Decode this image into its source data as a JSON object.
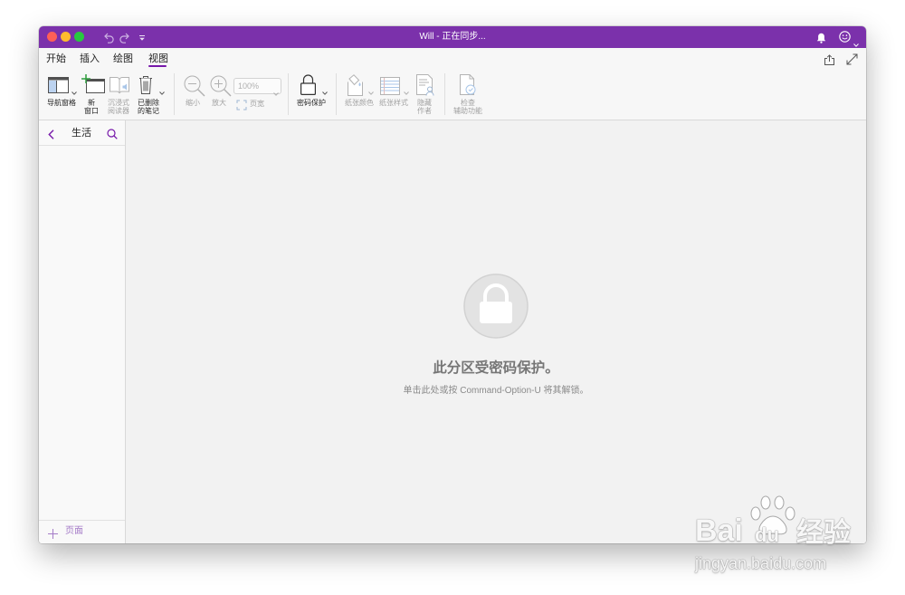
{
  "window": {
    "title": "Will - 正在同步..."
  },
  "theme": {
    "titlebar": "#7B31AB",
    "accent": "#7719AA",
    "ribbon_bg": "#F7F7F7",
    "canvas_bg": "#F2F2F2"
  },
  "quick_access": {
    "icons": [
      "undo-icon",
      "redo-icon",
      "customize-toolbar-icon"
    ]
  },
  "titlebar_right": {
    "icons": [
      "bell-icon",
      "feedback-smiley-icon",
      "chevron-down-icon"
    ]
  },
  "tabs": [
    {
      "label": "开始",
      "selected": false
    },
    {
      "label": "插入",
      "selected": false
    },
    {
      "label": "绘图",
      "selected": false
    },
    {
      "label": "视图",
      "selected": true
    }
  ],
  "tab_row_right": {
    "icons": [
      "share-icon",
      "expand-icon"
    ]
  },
  "ribbon": {
    "navigation_pane": {
      "label": "导航窗格",
      "enabled": true,
      "icon": "navigation-pane-icon"
    },
    "new_window": {
      "line1": "新",
      "line2": "窗口",
      "enabled": true,
      "icon": "new-window-icon"
    },
    "immersive_reader": {
      "line1": "沉浸式",
      "line2": "阅读器",
      "enabled": false,
      "icon": "immersive-reader-icon"
    },
    "deleted_notes": {
      "line1": "已删除",
      "line2": "的笔记",
      "enabled": true,
      "icon": "trash-icon"
    },
    "zoom_out": {
      "label": "缩小",
      "enabled": false,
      "icon": "zoom-out-icon"
    },
    "zoom_in": {
      "label": "放大",
      "enabled": false,
      "icon": "zoom-in-icon"
    },
    "zoom_level": {
      "value": "100%",
      "enabled": false
    },
    "page_width": {
      "label": "页宽",
      "enabled": false,
      "icon": "page-width-icon"
    },
    "password_protection": {
      "label": "密码保护",
      "enabled": true,
      "icon": "lock-icon"
    },
    "paper_color": {
      "label": "纸张颜色",
      "enabled": false,
      "icon": "paper-color-icon"
    },
    "paper_style": {
      "label": "纸张样式",
      "enabled": false,
      "icon": "paper-style-icon"
    },
    "hide_authors": {
      "line1": "隐藏",
      "line2": "作者",
      "enabled": false,
      "icon": "hide-authors-icon"
    },
    "check_accessibility": {
      "line1": "检查",
      "line2": "辅助功能",
      "enabled": false,
      "icon": "accessibility-icon"
    }
  },
  "sidebar": {
    "section": "生活",
    "add_page": "页面",
    "icons": [
      "back-chevron-icon",
      "search-icon",
      "plus-icon"
    ]
  },
  "main": {
    "locked_title": "此分区受密码保护。",
    "locked_hint": "单击此处或按 Command-Option-U 将其解锁。",
    "icon": "lock-circle-icon"
  },
  "watermark": {
    "brand_a": "Bai",
    "brand_b": "du",
    "brand_cjk": "经验",
    "url": "jingyan.baidu.com",
    "icon": "paw-logo-icon"
  }
}
